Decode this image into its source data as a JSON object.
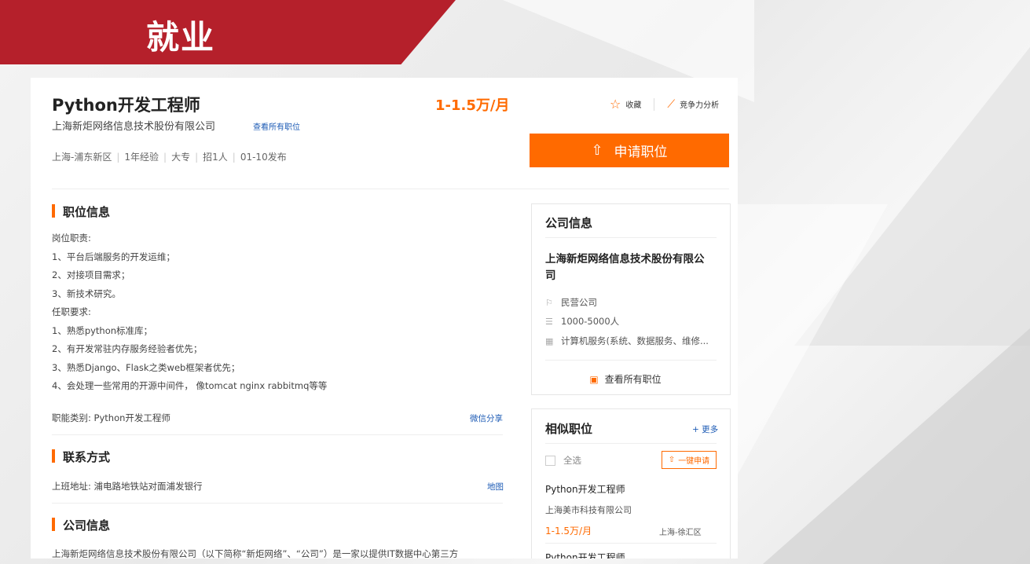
{
  "banner": {
    "title": "就业"
  },
  "job": {
    "title": "Python开发工程师",
    "salary": "1-1.5万/月",
    "company": "上海新炬网络信息技术股份有限公司",
    "view_all_jobs": "查看所有职位",
    "meta": [
      "上海-浦东新区",
      "1年经验",
      "大专",
      "招1人",
      "01-10发布"
    ]
  },
  "actions": {
    "favorite": "收藏",
    "analysis": "竞争力分析",
    "apply": "申请职位"
  },
  "sections": {
    "job_info": {
      "title": "职位信息",
      "lines": [
        "岗位职责:",
        " 1、平台后端服务的开发运维；",
        " 2、对接项目需求；",
        " 3、新技术研究。",
        "任职要求:",
        "1、熟悉python标准库；",
        "2、有开发常驻内存服务经验者优先；",
        "3、熟悉Django、Flask之类web框架者优先；",
        "4、会处理一些常用的开源中间件， 像tomcat nginx rabbitmq等等"
      ],
      "category": "职能类别:  Python开发工程师",
      "share": "微信分享"
    },
    "contact": {
      "title": "联系方式",
      "address": "上班地址:  浦电路地铁站对面浦发银行",
      "map": "地图"
    },
    "company_info": {
      "title": "公司信息",
      "text": "上海新炬网络信息技术股份有限公司（以下简称“新炬网络”、“公司”）是一家以提供IT数据中心第三方"
    }
  },
  "company_panel": {
    "title": "公司信息",
    "name": "上海新炬网络信息技术股份有限公司",
    "type": "民营公司",
    "size": "1000-5000人",
    "industry": "计算机服务(系统、数据服务、维修...",
    "view_all": "查看所有职位"
  },
  "similar_panel": {
    "title": "相似职位",
    "more": "+ 更多",
    "select_all": "全选",
    "one_click": "一键申请",
    "items": [
      {
        "title": "Python开发工程师",
        "company": "上海美市科技有限公司",
        "salary": "1-1.5万/月",
        "location": "上海-徐汇区"
      },
      {
        "title": "Python开发工程师"
      }
    ]
  }
}
